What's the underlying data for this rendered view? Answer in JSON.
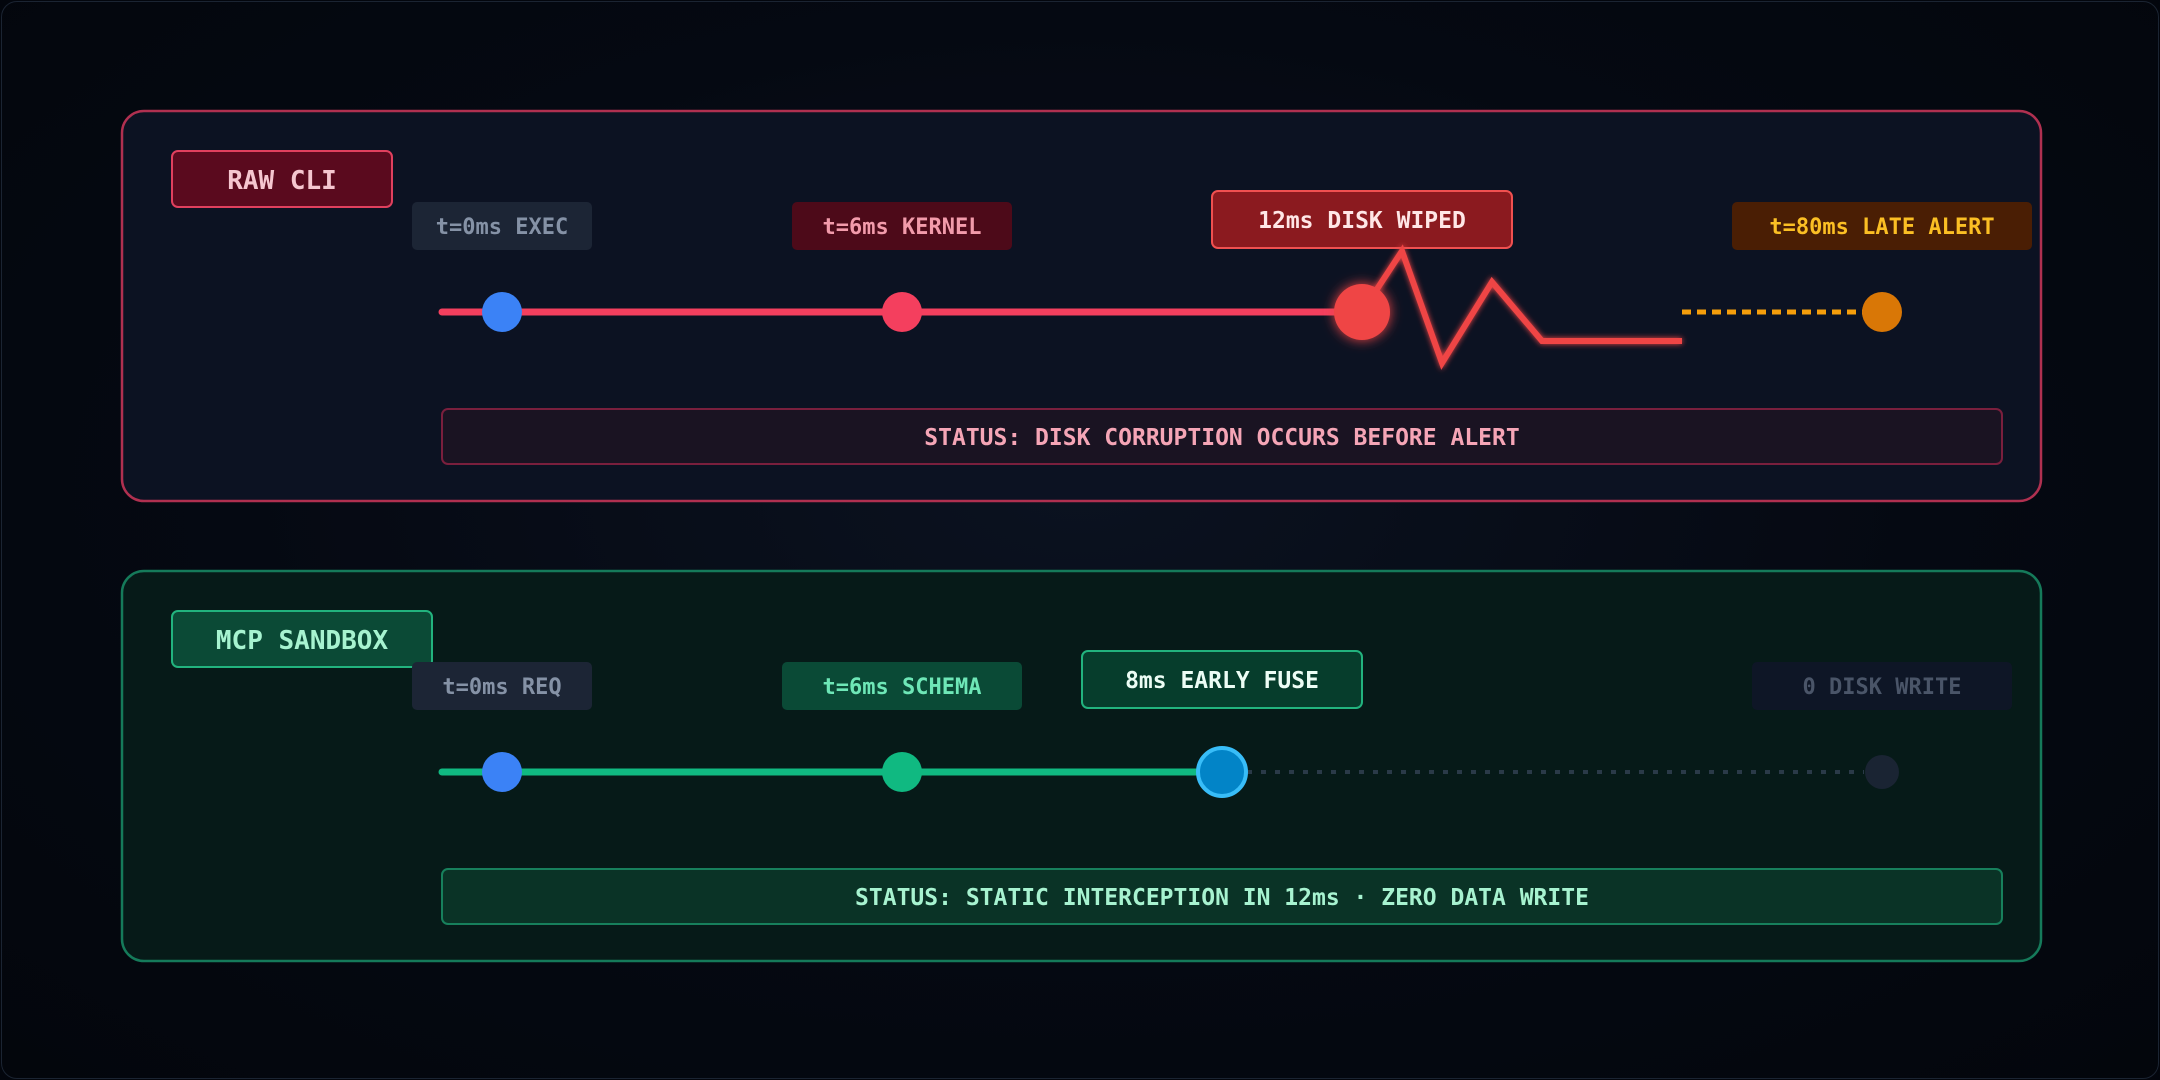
{
  "panels": {
    "raw": {
      "title": "RAW CLI",
      "labels": {
        "exec": "t=0ms EXEC",
        "kernel": "t=6ms KERNEL",
        "wiped": "12ms DISK WIPED",
        "alert": "t=80ms LATE ALERT"
      },
      "status": "STATUS: DISK CORRUPTION OCCURS BEFORE ALERT"
    },
    "mcp": {
      "title": "MCP SANDBOX",
      "labels": {
        "req": "t=0ms REQ",
        "schema": "t=6ms SCHEMA",
        "fuse": "8ms EARLY FUSE",
        "nowrite": "0 DISK WRITE"
      },
      "status": "STATUS: STATIC INTERCEPTION IN 12ms · ZERO DATA WRITE"
    }
  },
  "colors": {
    "raw_accent": "#f43f5e",
    "raw_wipe": "#ef4444",
    "alert_orange": "#f59e0b",
    "mcp_accent": "#10b981",
    "fuse_blue": "#0284c7",
    "start_blue": "#3b82f6"
  }
}
